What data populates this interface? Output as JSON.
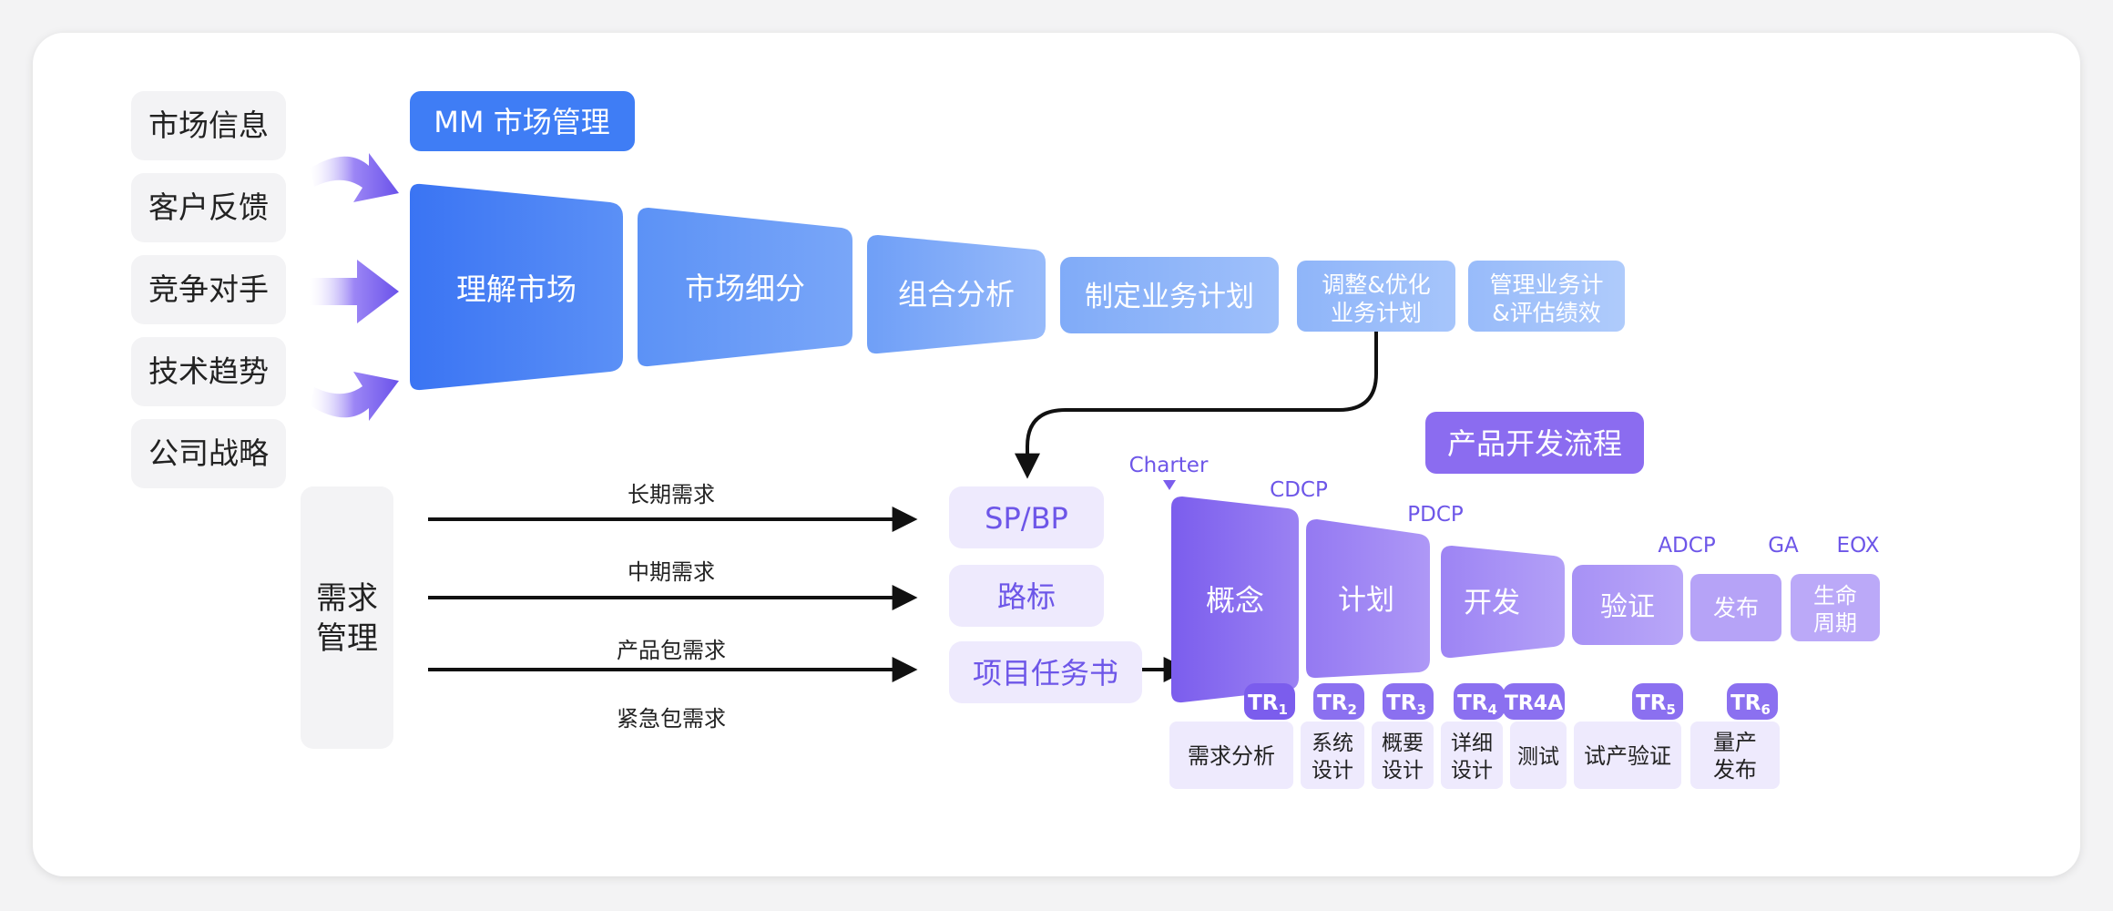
{
  "inputs": [
    "市场信息",
    "客户反馈",
    "竞争对手",
    "技术趋势",
    "公司战略"
  ],
  "mm": {
    "title": "MM 市场管理",
    "stages": [
      [
        "理解市场"
      ],
      [
        "市场细分"
      ],
      [
        "组合分析"
      ],
      [
        "制定业务计划"
      ],
      [
        "调整&优化",
        "业务计划"
      ],
      [
        "管理业务计",
        "&评估绩效"
      ]
    ]
  },
  "demand": {
    "title": [
      "需求",
      "管理"
    ],
    "flows": [
      "长期需求",
      "中期需求",
      "产品包需求",
      "紧急包需求"
    ]
  },
  "outputs": [
    "SP/BP",
    "路标",
    "项目任务书"
  ],
  "ipd": {
    "title": "产品开发流程",
    "decision_points": [
      "Charter",
      "CDCP",
      "PDCP",
      "ADCP",
      "GA",
      "EOX"
    ],
    "phases": [
      [
        "概念"
      ],
      [
        "计划"
      ],
      [
        "开发"
      ],
      [
        "验证"
      ],
      [
        "发布"
      ],
      [
        "生命",
        "周期"
      ]
    ],
    "reviews": [
      {
        "label": "TR",
        "sub": "1"
      },
      {
        "label": "TR",
        "sub": "2"
      },
      {
        "label": "TR",
        "sub": "3"
      },
      {
        "label": "TR",
        "sub": "4"
      },
      {
        "label": "TR4A",
        "sub": ""
      },
      {
        "label": "TR",
        "sub": "5"
      },
      {
        "label": "TR",
        "sub": "6"
      }
    ],
    "activities": [
      [
        "需求分析"
      ],
      [
        "系统",
        "设计"
      ],
      [
        "概要",
        "设计"
      ],
      [
        "详细",
        "设计"
      ],
      [
        "测试"
      ],
      [
        "试产验证"
      ],
      [
        "量产",
        "发布"
      ]
    ]
  },
  "colors": {
    "mm_blue": "#3f7df5",
    "mm_blue_light": "#a8c6fb",
    "ipd_purple": "#8b6cf0",
    "ipd_purple_light": "#b7a3f7",
    "label_purple": "#6d56e8",
    "soft_purple": "#eeeafd",
    "gray_box": "#f3f3f5"
  }
}
